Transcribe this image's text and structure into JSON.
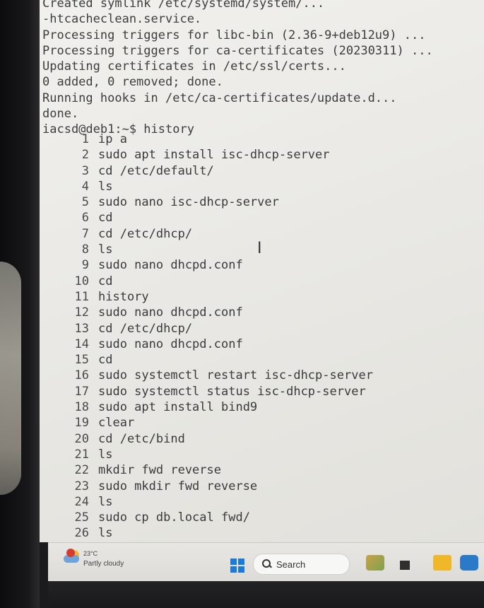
{
  "terminal": {
    "output_lines": [
      "Created symlink /etc/systemd/system/...",
      "-htcacheclean.service.",
      "Processing triggers for libc-bin (2.36-9+deb12u9) ...",
      "Processing triggers for ca-certificates (20230311) ...",
      "Updating certificates in /etc/ssl/certs...",
      "0 added, 0 removed; done.",
      "Running hooks in /etc/ca-certificates/update.d...",
      "done.",
      "iacsd@deb1:~$ history"
    ],
    "history": [
      {
        "n": "1",
        "cmd": "ip a"
      },
      {
        "n": "2",
        "cmd": "sudo apt install isc-dhcp-server"
      },
      {
        "n": "3",
        "cmd": "cd /etc/default/"
      },
      {
        "n": "4",
        "cmd": "ls"
      },
      {
        "n": "5",
        "cmd": "sudo nano isc-dhcp-server"
      },
      {
        "n": "6",
        "cmd": "cd"
      },
      {
        "n": "7",
        "cmd": "cd /etc/dhcp/"
      },
      {
        "n": "8",
        "cmd": "ls"
      },
      {
        "n": "9",
        "cmd": "sudo nano dhcpd.conf"
      },
      {
        "n": "10",
        "cmd": "cd"
      },
      {
        "n": "11",
        "cmd": "history"
      },
      {
        "n": "12",
        "cmd": "sudo nano dhcpd.conf"
      },
      {
        "n": "13",
        "cmd": "cd /etc/dhcp/"
      },
      {
        "n": "14",
        "cmd": "sudo nano dhcpd.conf"
      },
      {
        "n": "15",
        "cmd": "cd"
      },
      {
        "n": "16",
        "cmd": "sudo systemctl restart isc-dhcp-server"
      },
      {
        "n": "17",
        "cmd": "sudo systemctl status isc-dhcp-server"
      },
      {
        "n": "18",
        "cmd": "sudo apt install bind9"
      },
      {
        "n": "19",
        "cmd": "clear"
      },
      {
        "n": "20",
        "cmd": "cd /etc/bind"
      },
      {
        "n": "21",
        "cmd": "ls"
      },
      {
        "n": "22",
        "cmd": "mkdir fwd reverse"
      },
      {
        "n": "23",
        "cmd": "sudo mkdir fwd reverse"
      },
      {
        "n": "24",
        "cmd": "ls"
      },
      {
        "n": "25",
        "cmd": "sudo cp db.local fwd/"
      },
      {
        "n": "26",
        "cmd": "ls"
      }
    ],
    "text_color": "#3d3d3d",
    "background": "#eeede9"
  },
  "taskbar": {
    "weather_temp": "23°C",
    "weather_desc": "Partly cloudy",
    "weather_icon": "partly-cloudy-icon",
    "search_label": "Search",
    "search_icon": "search-icon",
    "start_icon": "windows-logo-icon",
    "pinned_apps": [
      "app-icon",
      "terminal-icon",
      "file-explorer-icon",
      "outlook-icon"
    ]
  }
}
